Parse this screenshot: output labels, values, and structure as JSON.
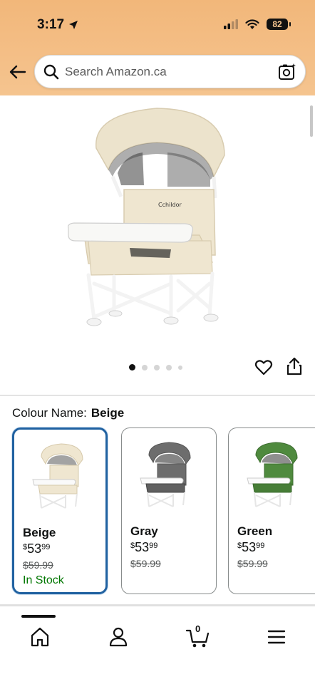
{
  "status_bar": {
    "time": "3:17",
    "battery": "82"
  },
  "search": {
    "placeholder": "Search Amazon.ca"
  },
  "product": {
    "cut_title_fragment": "...g...p...",
    "image_name": "portable baby high chair with canopy",
    "brand_on_chair": "Cchildor",
    "image_count": 5,
    "active_image_index": 0
  },
  "colour": {
    "label": "Colour Name:",
    "selected": "Beige"
  },
  "swatches": [
    {
      "name": "Beige",
      "currency": "$",
      "price_whole": "53",
      "price_cents": "99",
      "old_price": "$59.99",
      "stock": "In Stock",
      "color": "#efe6d0",
      "selected": true
    },
    {
      "name": "Gray",
      "currency": "$",
      "price_whole": "53",
      "price_cents": "99",
      "old_price": "$59.99",
      "stock": "",
      "color": "#6d6d6d",
      "selected": false
    },
    {
      "name": "Green",
      "currency": "$",
      "price_whole": "53",
      "price_cents": "99",
      "old_price": "$59.99",
      "stock": "",
      "color": "#4f8a3e",
      "selected": false
    }
  ],
  "bottom_nav": {
    "items": [
      "home-icon",
      "account-icon",
      "cart-icon",
      "menu-icon"
    ],
    "cart_count": "0",
    "active": "home-icon"
  },
  "colors": {
    "header_top": "#f2b77a",
    "selected_border": "#2162a1",
    "in_stock": "#007600"
  }
}
